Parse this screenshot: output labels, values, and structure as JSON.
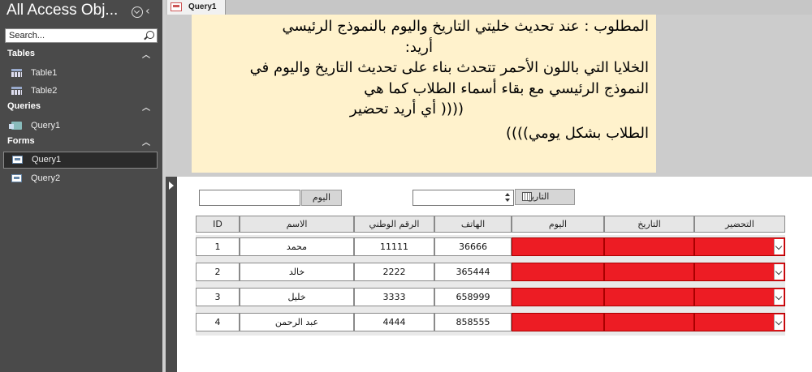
{
  "navigation_pane": {
    "title": "All Access Obj...",
    "search_placeholder": "Search...",
    "groups": [
      {
        "label": "Tables",
        "items": [
          {
            "label": "Table1",
            "icon": "table-icon"
          },
          {
            "label": "Table2",
            "icon": "table-icon"
          }
        ]
      },
      {
        "label": "Queries",
        "items": [
          {
            "label": "Query1",
            "icon": "query-icon"
          }
        ]
      },
      {
        "label": "Forms",
        "items": [
          {
            "label": "Query1",
            "icon": "form-icon",
            "selected": true
          },
          {
            "label": "Query2",
            "icon": "form-icon"
          }
        ]
      }
    ]
  },
  "document_tab": {
    "label": "Query1"
  },
  "note": {
    "lines": [
      "المطلوب : عند تحديث خليتي التاريخ واليوم بالنموذج الرئيسي",
      "أريد:",
      "الخلايا التي باللون الأحمر تتحدث بناء على تحديث التاريخ واليوم في",
      "النموذج الرئيسي   مع بقاء أسماء الطلاب كما هي",
      "(((( أي أريد تحضير",
      "الطلاب بشكل يومي))))"
    ]
  },
  "filters": {
    "today_label": "اليوم",
    "today_value": "",
    "date_label": "التاريخ",
    "date_value": ""
  },
  "grid": {
    "columns": [
      "ID",
      "الاسم",
      "الرقم الوطني",
      "الهاتف",
      "اليوم",
      "التاريخ",
      "التحضير"
    ],
    "rows": [
      {
        "id": "1",
        "name": "محمد",
        "national_id": "11111",
        "phone": "36666"
      },
      {
        "id": "2",
        "name": "خالد",
        "national_id": "2222",
        "phone": "365444"
      },
      {
        "id": "3",
        "name": "خليل",
        "national_id": "3333",
        "phone": "658999"
      },
      {
        "id": "4",
        "name": "عبد الرحمن",
        "national_id": "4444",
        "phone": "858555"
      }
    ]
  },
  "colors": {
    "highlight": "#ed1c24",
    "note_background": "#fff2cc",
    "nav_background": "#4a4a4a"
  }
}
